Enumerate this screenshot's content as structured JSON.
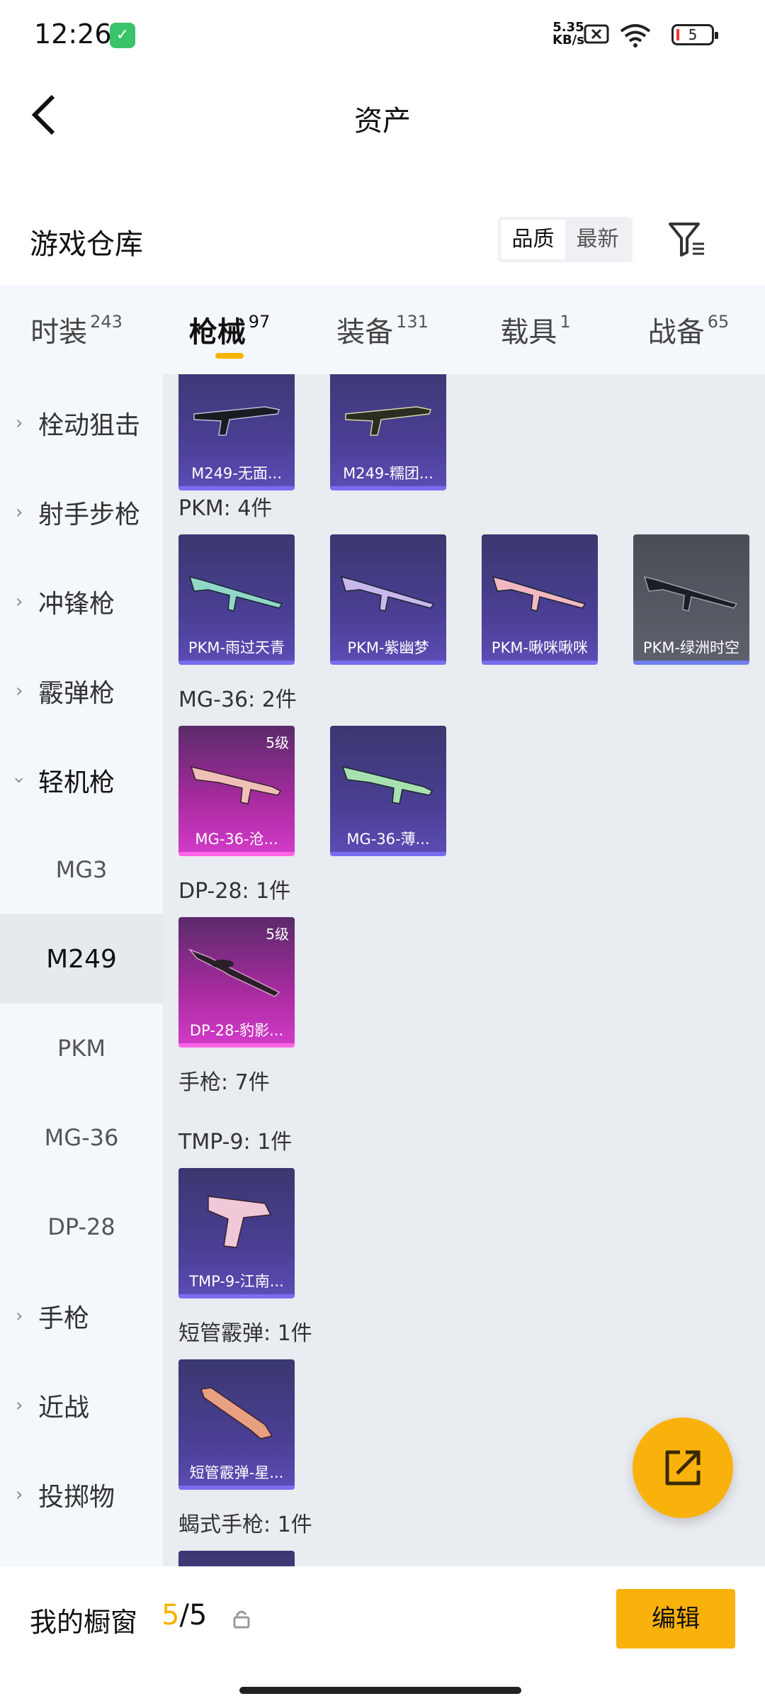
{
  "status_bar": {
    "time": "12:26",
    "net_speed_value": "5.35",
    "net_speed_unit": "KB/s",
    "battery": "5"
  },
  "header": {
    "title": "资产"
  },
  "warehouse": {
    "title": "游戏仓库",
    "sort_options": [
      "品质",
      "最新"
    ],
    "sort_selected": "品质"
  },
  "tabs": [
    {
      "label": "时装",
      "count": "243"
    },
    {
      "label": "枪械",
      "count": "97",
      "active": true
    },
    {
      "label": "装备",
      "count": "131"
    },
    {
      "label": "载具",
      "count": "1"
    },
    {
      "label": "战备",
      "count": "65"
    }
  ],
  "sidebar": {
    "categories": [
      {
        "label": "栓动狙击"
      },
      {
        "label": "射手步枪"
      },
      {
        "label": "冲锋枪"
      },
      {
        "label": "霰弹枪"
      },
      {
        "label": "轻机枪",
        "expanded": true
      }
    ],
    "subcategories": [
      "MG3",
      "M249",
      "PKM",
      "MG-36",
      "DP-28"
    ],
    "selected_sub": "M249",
    "more_categories": [
      {
        "label": "手枪"
      },
      {
        "label": "近战"
      },
      {
        "label": "投掷物"
      }
    ]
  },
  "content": {
    "top_partial_cards": [
      {
        "name": "M249-无面..."
      },
      {
        "name": "M249-糯团..."
      }
    ],
    "groups": [
      {
        "label": "PKM: 4件",
        "cards": [
          {
            "name": "PKM-雨过天青",
            "style": "purple"
          },
          {
            "name": "PKM-紫幽梦",
            "style": "purple"
          },
          {
            "name": "PKM-啾咪啾咪",
            "style": "purple"
          },
          {
            "name": "PKM-绿洲时空",
            "style": "gray"
          }
        ]
      },
      {
        "label": "MG-36: 2件",
        "cards": [
          {
            "name": "MG-36-沧...",
            "style": "pink",
            "level": "5级"
          },
          {
            "name": "MG-36-薄...",
            "style": "purple"
          }
        ]
      },
      {
        "label": "DP-28: 1件",
        "cards": [
          {
            "name": "DP-28-豹影...",
            "style": "pink",
            "level": "5级"
          }
        ]
      },
      {
        "label": "手枪: 7件",
        "cards": []
      },
      {
        "label": "TMP-9: 1件",
        "cards": [
          {
            "name": "TMP-9-江南...",
            "style": "purple"
          }
        ]
      },
      {
        "label": "短管霰弹: 1件",
        "cards": [
          {
            "name": "短管霰弹-星...",
            "style": "purple"
          }
        ]
      },
      {
        "label": "蝎式手枪: 1件",
        "cards": []
      }
    ]
  },
  "bottom_bar": {
    "showcase_label": "我的橱窗",
    "showcase_current": "5",
    "showcase_total": "/5",
    "edit_label": "编辑"
  },
  "colors": {
    "accent": "#f9b10c",
    "underline": "#f5b400",
    "card_purple": "#4b3f95",
    "card_pink": "#c236b6",
    "card_gray": "#5e616b"
  },
  "icons": [
    "back-arrow-icon",
    "filter-icon",
    "chevron-right-icon",
    "chevron-down-icon",
    "share-icon",
    "lock-icon",
    "shield-icon",
    "wifi-icon",
    "sim-off-icon",
    "battery-icon"
  ]
}
